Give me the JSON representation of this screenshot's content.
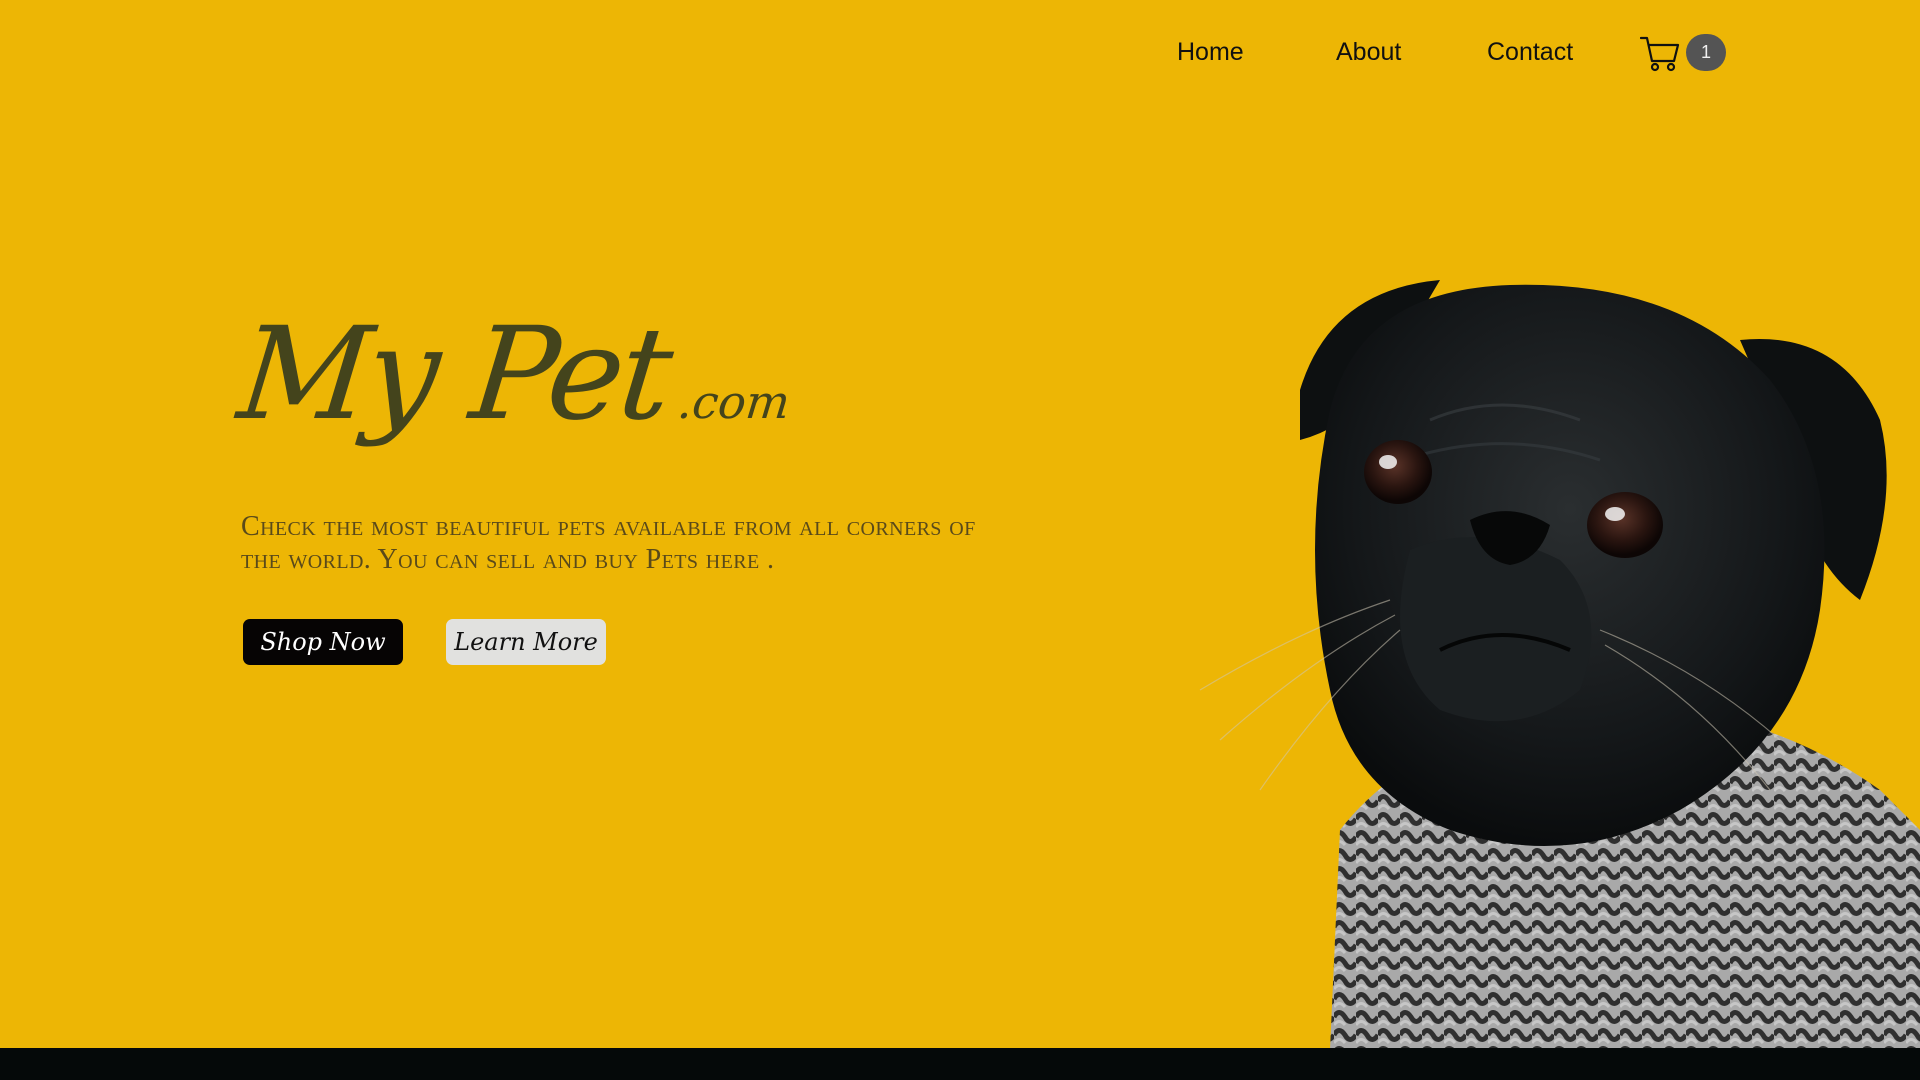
{
  "nav": {
    "links": [
      "Home",
      "About",
      "Contact"
    ],
    "cart": {
      "icon": "cart-icon",
      "count": "1"
    }
  },
  "hero": {
    "brand": "My Pet",
    "brand_suffix": ".com",
    "tagline": "Check the most  beautiful pets available from all corners of the world. You can sell and buy Pets here .",
    "buttons": {
      "primary": "Shop Now",
      "secondary": "Learn More"
    },
    "image_icon": "pug-dog-photo"
  },
  "colors": {
    "background": "#EDB605",
    "brand_text": "#44441C",
    "primary_button": "#060404",
    "secondary_button": "#E1E1DF",
    "badge": "#545454",
    "footer": "#050909"
  }
}
